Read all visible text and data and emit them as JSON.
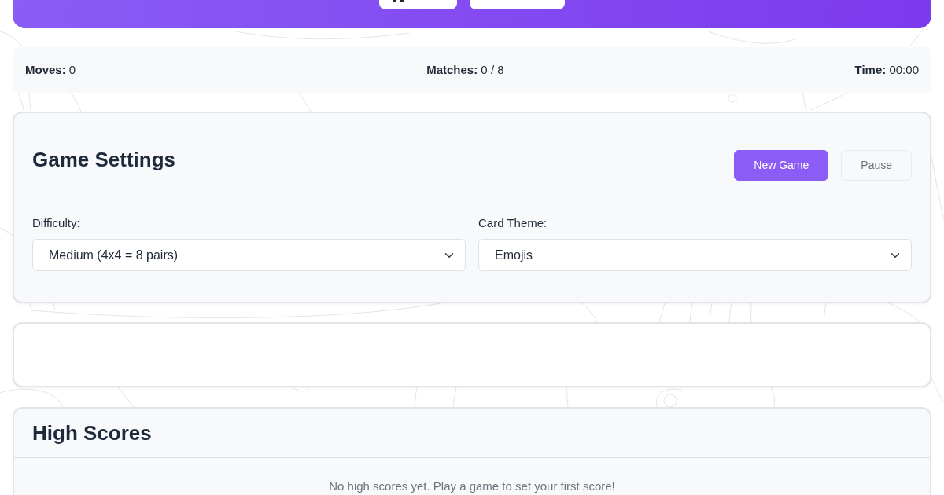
{
  "stats": [
    {
      "label": "Moves:",
      "value": "0"
    },
    {
      "label": "Matches:",
      "value": "0 / 8"
    },
    {
      "label": "Time:",
      "value": "00:00"
    }
  ],
  "settings": {
    "title": "Game Settings",
    "buttons": [
      {
        "label": "New Game",
        "kind": "primary",
        "disabled": false
      },
      {
        "label": "Pause",
        "kind": "secondary",
        "disabled": true
      }
    ],
    "fields": [
      {
        "label": "Difficulty:",
        "value": "Medium (4x4 = 8 pairs)"
      },
      {
        "label": "Card Theme:",
        "value": "Emojis"
      }
    ]
  },
  "high_scores": {
    "title": "High Scores",
    "empty_message": "No high scores yet. Play a game to set your first score!"
  }
}
